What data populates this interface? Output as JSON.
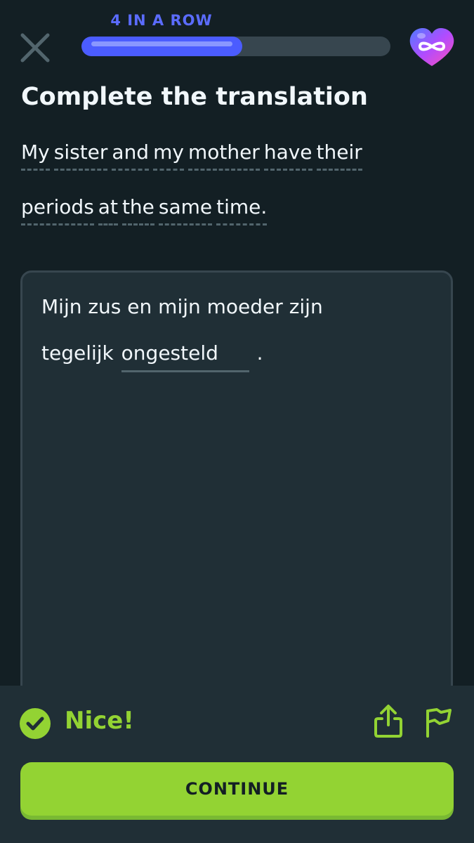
{
  "header": {
    "streak_label": "4 IN A ROW",
    "progress_fraction": 0.52,
    "colors": {
      "progress": "#4b5cff",
      "track": "#37464f",
      "streak": "#5b6cff"
    },
    "icons": {
      "close": "close-icon",
      "hearts": "infinity-heart-icon"
    }
  },
  "challenge": {
    "title": "Complete the translation",
    "prompt_line_1": [
      "My",
      "sister",
      "and",
      "my",
      "mother",
      "have",
      "their"
    ],
    "prompt_line_2": [
      "periods",
      "at",
      "the",
      "same",
      "time."
    ]
  },
  "answer": {
    "line_1": "Mijn zus en mijn moeder zijn",
    "line_2_prefix": "tegelijk",
    "blank_value": "ongesteld",
    "line_2_suffix": "."
  },
  "feedback": {
    "message": "Nice!",
    "continue_label": "CONTINUE",
    "colors": {
      "accent": "#93d333",
      "panel": "#202f36"
    },
    "icons": {
      "status": "check-circle-icon",
      "share": "share-icon",
      "report": "flag-icon"
    }
  }
}
